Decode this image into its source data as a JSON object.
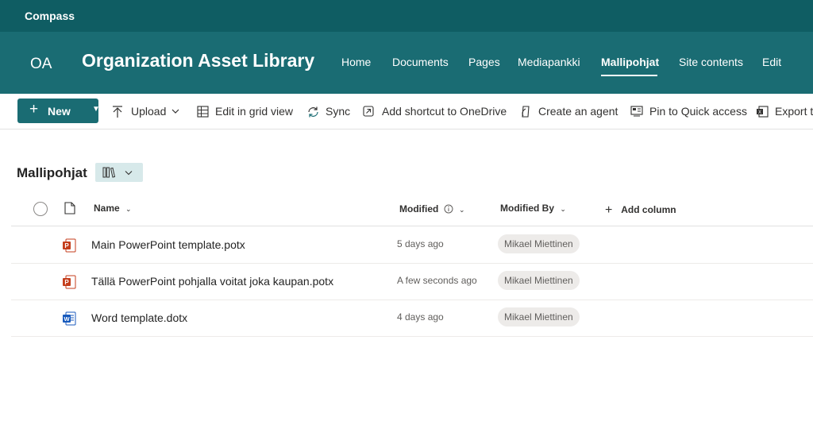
{
  "app": {
    "title": "Compass"
  },
  "site": {
    "logo_text": "OA",
    "title": "Organization Asset Library"
  },
  "nav": {
    "items": [
      {
        "label": "Home"
      },
      {
        "label": "Documents"
      },
      {
        "label": "Pages"
      },
      {
        "label": "Mediapankki"
      },
      {
        "label": "Mallipohjat",
        "active": true
      },
      {
        "label": "Site contents"
      },
      {
        "label": "Edit"
      }
    ]
  },
  "toolbar": {
    "new_label": "New",
    "new_icon": "plus-icon",
    "upload_label": "Upload",
    "grid_label": "Edit in grid view",
    "sync_label": "Sync",
    "shortcut_label": "Add shortcut to OneDrive",
    "agent_label": "Create an agent",
    "pin_label": "Pin to Quick access",
    "export_label": "Export to"
  },
  "library": {
    "title": "Mallipohjat",
    "view_icon": "library-view-icon"
  },
  "columns": {
    "name": "Name",
    "modified": "Modified",
    "modified_by": "Modified By",
    "add_column": "Add column"
  },
  "files": [
    {
      "name": "Main PowerPoint template.potx",
      "modified": "5 days ago",
      "modified_by": "Mikael Miettinen",
      "type": "powerpoint"
    },
    {
      "name": "Tällä PowerPoint pohjalla voitat joka kaupan.potx",
      "modified": "A few seconds ago",
      "modified_by": "Mikael Miettinen",
      "type": "powerpoint"
    },
    {
      "name": "Word template.dotx",
      "modified": "4 days ago",
      "modified_by": "Mikael Miettinen",
      "type": "word"
    }
  ],
  "colors": {
    "topbar": "#0f5d63",
    "header": "#1a6c73",
    "accent": "#1a6c73",
    "powerpoint": "#c43e1c",
    "word": "#185abd"
  }
}
